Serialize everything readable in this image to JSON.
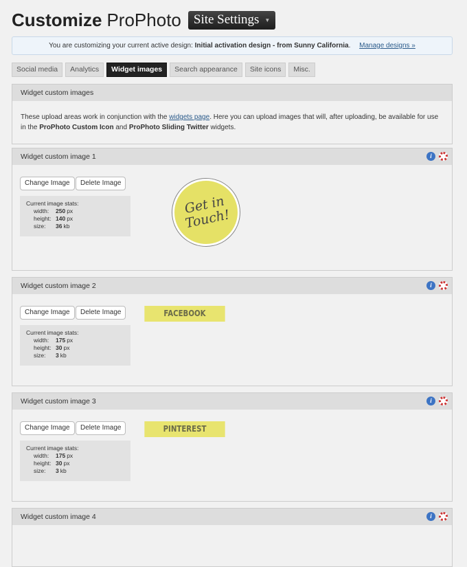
{
  "title": {
    "bold": "Customize",
    "rest": "ProPhoto",
    "menu": "Site Settings"
  },
  "notice": {
    "prefix": "You are customizing your current active design:",
    "design": "Initial activation design - from Sunny California",
    "suffix": ".",
    "link": "Manage designs »"
  },
  "tabs": [
    "Social media",
    "Analytics",
    "Widget images",
    "Search appearance",
    "Site icons",
    "Misc."
  ],
  "intro": {
    "title": "Widget custom images",
    "t1": "These upload areas work in conjunction with the ",
    "link": "widgets page",
    "t2": ". Here you can upload images that will, after uploading, be available for use in the ",
    "b1": "ProPhoto Custom Icon",
    "t3": " and ",
    "b2": "ProPhoto Sliding Twitter",
    "t4": " widgets."
  },
  "common": {
    "change": "Change Image",
    "delete": "Delete Image",
    "stats": "Current image stats:",
    "width": "width:",
    "height": "height:",
    "size": "size:",
    "px": "px",
    "kb": "kb"
  },
  "images": [
    {
      "title": "Widget custom image 1",
      "width": "250",
      "height": "140",
      "size": "36",
      "image_text": "Get in Touch!"
    },
    {
      "title": "Widget custom image 2",
      "width": "175",
      "height": "30",
      "size": "3",
      "image_text": "FACEBOOK"
    },
    {
      "title": "Widget custom image 3",
      "width": "175",
      "height": "30",
      "size": "3",
      "image_text": "PINTEREST"
    },
    {
      "title": "Widget custom image 4"
    }
  ]
}
